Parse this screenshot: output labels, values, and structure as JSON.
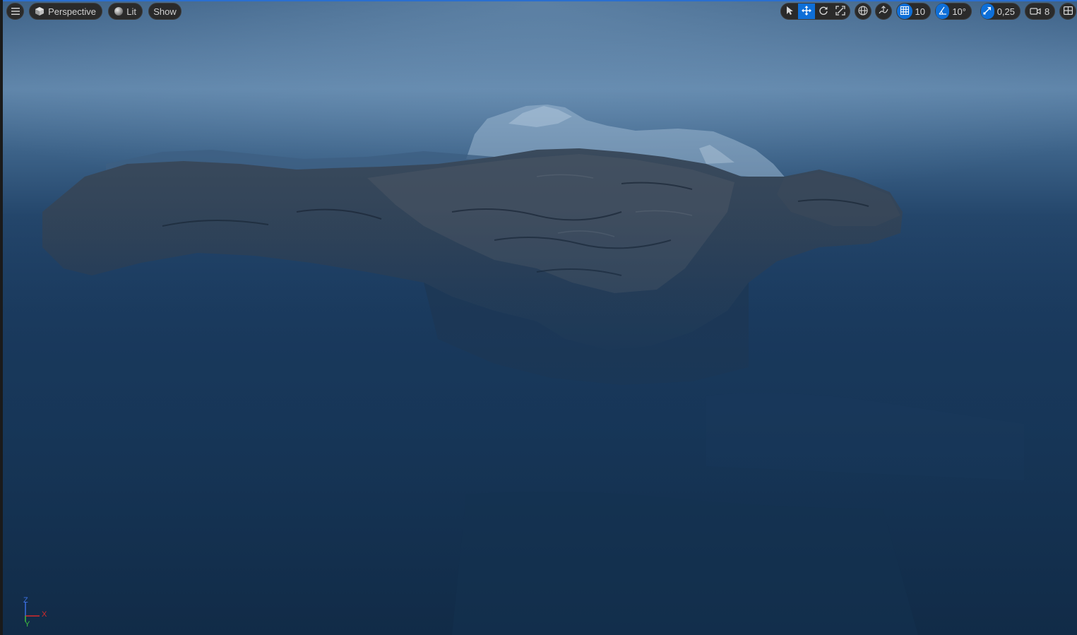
{
  "toolbar_left": {
    "menu_icon": "hamburger-icon",
    "view_mode": {
      "icon": "cube-icon",
      "label": "Perspective"
    },
    "lighting": {
      "icon": "sphere-icon",
      "label": "Lit"
    },
    "show": {
      "label": "Show"
    }
  },
  "toolbar_right": {
    "transform_tools": [
      {
        "name": "select-tool",
        "icon": "cursor-arrow-icon",
        "active": false
      },
      {
        "name": "translate-tool",
        "icon": "move-arrows-icon",
        "active": true
      },
      {
        "name": "rotate-tool",
        "icon": "rotate-icon",
        "active": false
      },
      {
        "name": "scale-tool",
        "icon": "scale-icon",
        "active": false
      }
    ],
    "world_local_icon": "globe-icon",
    "surface_snap_icon": "surface-snap-icon",
    "grid_snap": {
      "icon": "grid-icon",
      "value": "10",
      "active": true
    },
    "rotation_snap": {
      "icon": "angle-icon",
      "value": "10°",
      "active": true
    },
    "scale_snap": {
      "icon": "scale-snap-icon",
      "value": "0,25",
      "active": true
    },
    "camera_speed": {
      "icon": "camera-icon",
      "value": "8"
    },
    "layout_icon": "viewport-layout-icon"
  },
  "axis_gizmo": {
    "z": "Z",
    "x": "X",
    "y": "Y"
  },
  "colors": {
    "accent": "#0e6fd8",
    "axis_x": "#d62a2a",
    "axis_y": "#3fbf3f",
    "axis_z": "#3b6fe0"
  }
}
